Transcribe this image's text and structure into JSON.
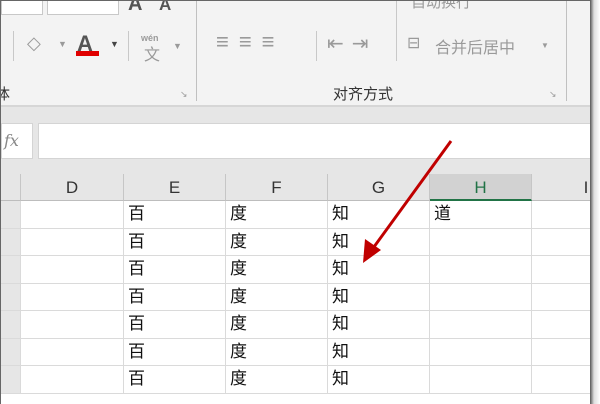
{
  "ribbon": {
    "font_group_label_partial": "体",
    "alignment_group_label": "对齐方式",
    "wrap_text_label": "自动换行",
    "merge_center_label": "合并后居中",
    "font_color": "#e00000",
    "phonetic_label": "wén",
    "phonetic_char": "文",
    "font_color_letter": "A",
    "increase_font": "A",
    "decrease_font": "A"
  },
  "formula_bar": {
    "fx_label": "fx",
    "value": ""
  },
  "columns": [
    "D",
    "E",
    "F",
    "G",
    "H",
    "I"
  ],
  "selected_column": "H",
  "rows": [
    [
      "",
      "百",
      "度",
      "知",
      "道",
      ""
    ],
    [
      "",
      "百",
      "度",
      "知",
      "",
      ""
    ],
    [
      "",
      "百",
      "度",
      "知",
      "",
      ""
    ],
    [
      "",
      "百",
      "度",
      "知",
      "",
      ""
    ],
    [
      "",
      "百",
      "度",
      "知",
      "",
      ""
    ],
    [
      "",
      "百",
      "度",
      "知",
      "",
      ""
    ],
    [
      "",
      "百",
      "度",
      "知",
      "",
      ""
    ]
  ],
  "annotation_color": "#c00000"
}
